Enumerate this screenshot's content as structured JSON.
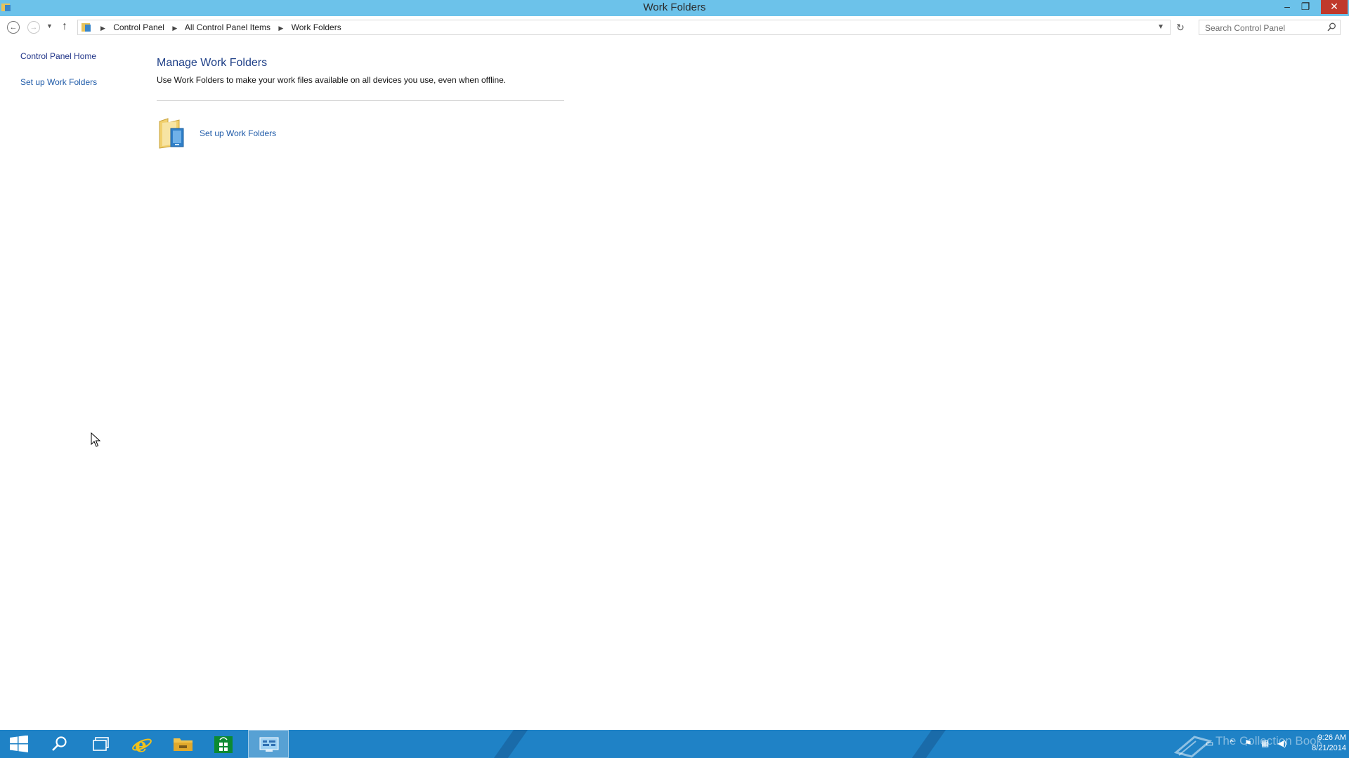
{
  "window": {
    "title": "Work Folders",
    "minimize_glyph": "–",
    "restore_glyph": "❐",
    "close_glyph": "✕"
  },
  "address_bar": {
    "breadcrumbs": [
      "Control Panel",
      "All Control Panel Items",
      "Work Folders"
    ],
    "search_placeholder": "Search Control Panel"
  },
  "left_pane": {
    "home_link": "Control Panel Home",
    "setup_link": "Set up Work Folders"
  },
  "main": {
    "title": "Manage Work Folders",
    "description": "Use Work Folders to make your work files available on all devices you use, even when offline.",
    "task_label": "Set up Work Folders"
  },
  "taskbar": {
    "watermark": "The Collection Book",
    "time": "9:26 AM",
    "date": "8/21/2014",
    "accent_color": "#1f82c6"
  },
  "colors": {
    "titlebar": "#6cc2ea",
    "link": "#1e5aa8",
    "heading": "#1e3f87"
  }
}
